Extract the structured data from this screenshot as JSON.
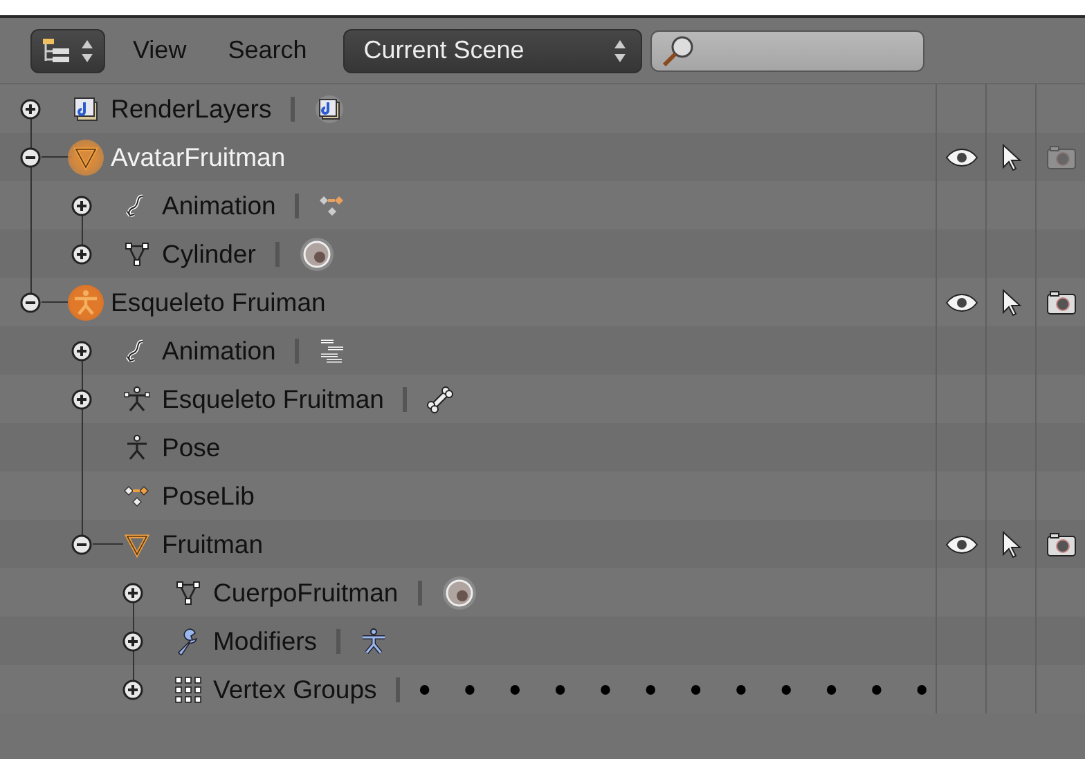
{
  "header": {
    "menus": [
      "View",
      "Search"
    ],
    "scene_dropdown": {
      "value": "Current Scene"
    }
  },
  "outliner": {
    "items": [
      {
        "label": "RenderLayers",
        "kind": "renderlayers",
        "expanded": false,
        "selected": false,
        "active": false,
        "data": {
          "kind": "renderlayers"
        }
      },
      {
        "label": "AvatarFruitman",
        "kind": "mesh-object",
        "expanded": true,
        "selected": true,
        "active": true,
        "restrict": {
          "visible": true,
          "selectable": true,
          "renderable": false
        },
        "children": [
          {
            "label": "Animation",
            "kind": "animation",
            "expanded": false,
            "selected": false,
            "active": false,
            "data": {
              "kind": "action"
            }
          },
          {
            "label": "Cylinder",
            "kind": "mesh-data",
            "expanded": false,
            "selected": false,
            "active": false,
            "data": {
              "kind": "material"
            }
          }
        ]
      },
      {
        "label": "Esqueleto Fruiman",
        "kind": "armature-object",
        "expanded": true,
        "selected": true,
        "active": false,
        "restrict": {
          "visible": true,
          "selectable": true,
          "renderable": true
        },
        "children": [
          {
            "label": "Animation",
            "kind": "animation",
            "expanded": false,
            "selected": false,
            "active": false,
            "data": {
              "kind": "nla"
            }
          },
          {
            "label": "Esqueleto Fruitman",
            "kind": "armature-data",
            "expanded": false,
            "selected": false,
            "active": false,
            "data": {
              "kind": "bone"
            }
          },
          {
            "label": "Pose",
            "kind": "pose",
            "selected": false,
            "active": false
          },
          {
            "label": "PoseLib",
            "kind": "poselib",
            "selected": false,
            "active": false
          },
          {
            "label": "Fruitman",
            "kind": "mesh-object",
            "expanded": true,
            "selected": false,
            "active": false,
            "restrict": {
              "visible": true,
              "selectable": true,
              "renderable": true
            },
            "children": [
              {
                "label": "CuerpoFruitman",
                "kind": "mesh-data",
                "expanded": false,
                "selected": false,
                "active": false,
                "data": {
                  "kind": "material"
                }
              },
              {
                "label": "Modifiers",
                "kind": "modifiers",
                "expanded": false,
                "selected": false,
                "active": false,
                "data": {
                  "kind": "armature-modifier"
                }
              },
              {
                "label": "Vertex Groups",
                "kind": "vertex-groups",
                "expanded": false,
                "selected": false,
                "active": false,
                "data": {
                  "kind": "dots"
                }
              }
            ]
          }
        ]
      }
    ]
  }
}
